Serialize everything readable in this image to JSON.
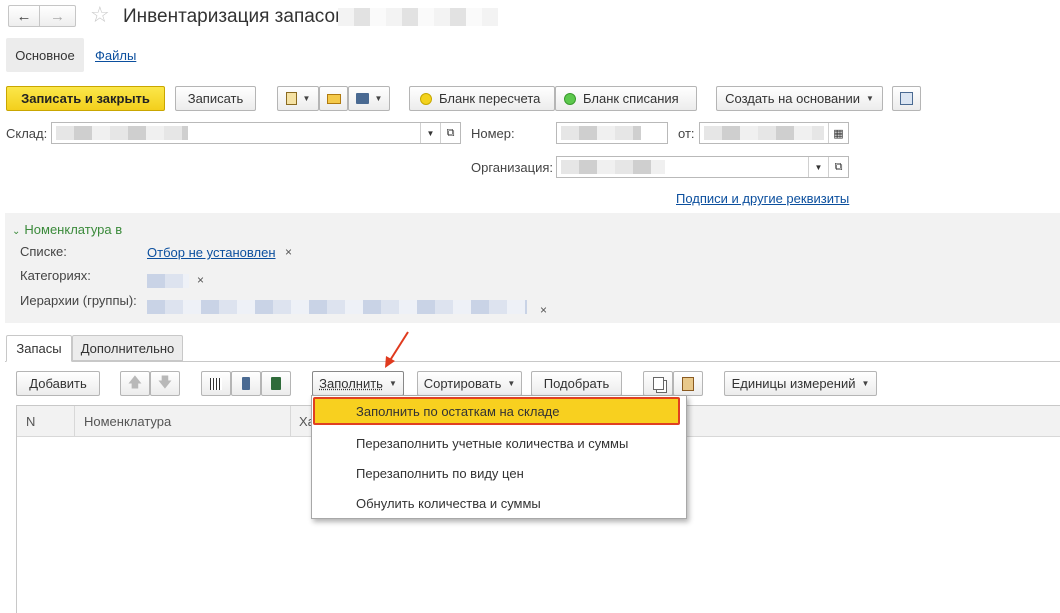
{
  "header": {
    "title": "Инвентаризация запасов",
    "back_icon": "arrow-left-icon",
    "forward_icon": "arrow-right-icon",
    "star_icon": "star-icon"
  },
  "nav_tabs": [
    {
      "label": "Основное"
    },
    {
      "label": "Файлы"
    }
  ],
  "toolbar": {
    "save_close": "Записать и закрыть",
    "save": "Записать",
    "blank_recount": "Бланк пересчета",
    "blank_writeoff": "Бланк списания",
    "create_based_on": "Создать на основании"
  },
  "form": {
    "warehouse_label": "Склад:",
    "number_label": "Номер:",
    "from_label": "от:",
    "organization_label": "Организация:",
    "signatures_link": "Подписи и другие реквизиты"
  },
  "filter": {
    "header": "Номенклатура в",
    "lists_label": "Списке:",
    "lists_value": "Отбор не установлен",
    "categories_label": "Категориях:",
    "hierarchy_label": "Иерархии (группы):",
    "clear_symbol": "×"
  },
  "tabs": [
    {
      "label": "Запасы"
    },
    {
      "label": "Дополнительно"
    }
  ],
  "table_toolbar": {
    "add": "Добавить",
    "fill": "Заполнить",
    "sort": "Сортировать",
    "pick": "Подобрать",
    "units": "Единицы измерений"
  },
  "table": {
    "columns": [
      "N",
      "Номенклатура",
      "Ха"
    ]
  },
  "fill_menu": {
    "items": [
      {
        "label": "Заполнить по остаткам на складе",
        "highlighted": true
      },
      {
        "label": "Перезаполнить учетные количества и суммы"
      },
      {
        "label": "Перезаполнить по виду цен"
      },
      {
        "label": "Обнулить количества и суммы"
      }
    ]
  },
  "colors": {
    "accent_yellow": "#f5d21f",
    "highlight_border": "#e04020",
    "link_blue": "#0b4f9e",
    "filter_green": "#3a8a3a"
  }
}
